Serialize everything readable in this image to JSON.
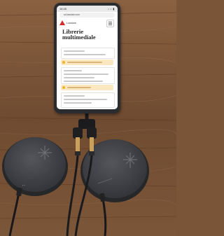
{
  "phone": {
    "status_time": "16:45",
    "status_icons": "• • ▮",
    "url": "sd.lasslab.com",
    "brand": "Lasslab",
    "page_title": "Librerie multimediale"
  },
  "colors": {
    "table_wood": "#7a5538",
    "pad_fabric": "#3f4044",
    "phone_body": "#2b2c30",
    "logo_red": "#d22c2c",
    "section_highlight": "#fbe7c0"
  }
}
